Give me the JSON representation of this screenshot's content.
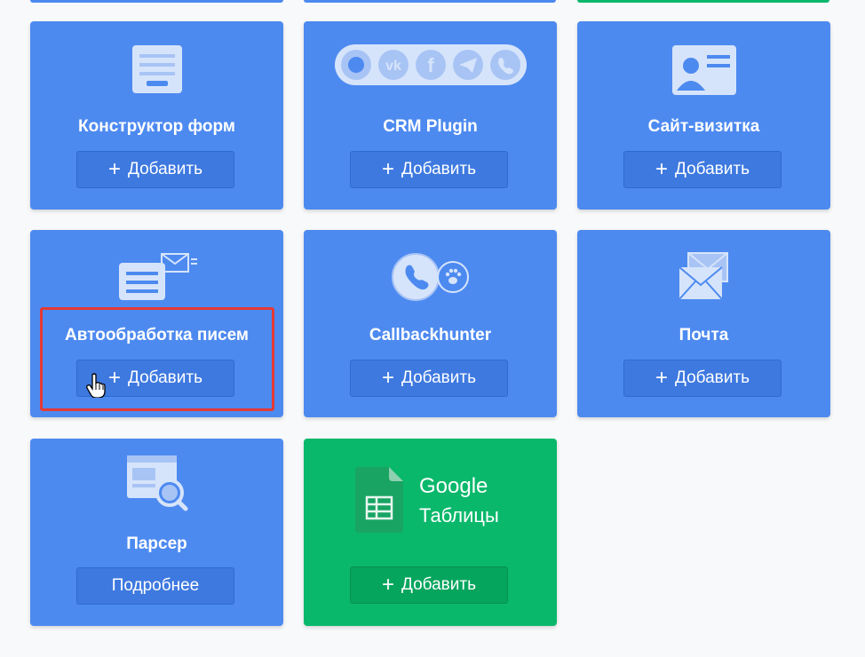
{
  "colors": {
    "card_blue": "#4d8af0",
    "card_green": "#0ab86b",
    "highlight": "#e53935"
  },
  "cards": [
    {
      "title": "Конструктор форм",
      "button": "Добавить",
      "icon": "form-icon"
    },
    {
      "title": "CRM Plugin",
      "button": "Добавить",
      "icon": "messengers-icon"
    },
    {
      "title": "Сайт-визитка",
      "button": "Добавить",
      "icon": "business-card-icon"
    },
    {
      "title": "Автообработка писем",
      "button": "Добавить",
      "icon": "mail-processing-icon"
    },
    {
      "title": "Callbackhunter",
      "button": "Добавить",
      "icon": "callback-icon"
    },
    {
      "title": "Почта",
      "button": "Добавить",
      "icon": "envelope-icon"
    },
    {
      "title": "Парсер",
      "button": "Подробнее",
      "icon": "parser-icon"
    },
    {
      "logo_line1": "Google",
      "logo_line2": "Таблицы",
      "button": "Добавить",
      "icon": "google-sheets-icon"
    }
  ],
  "plus": "+"
}
